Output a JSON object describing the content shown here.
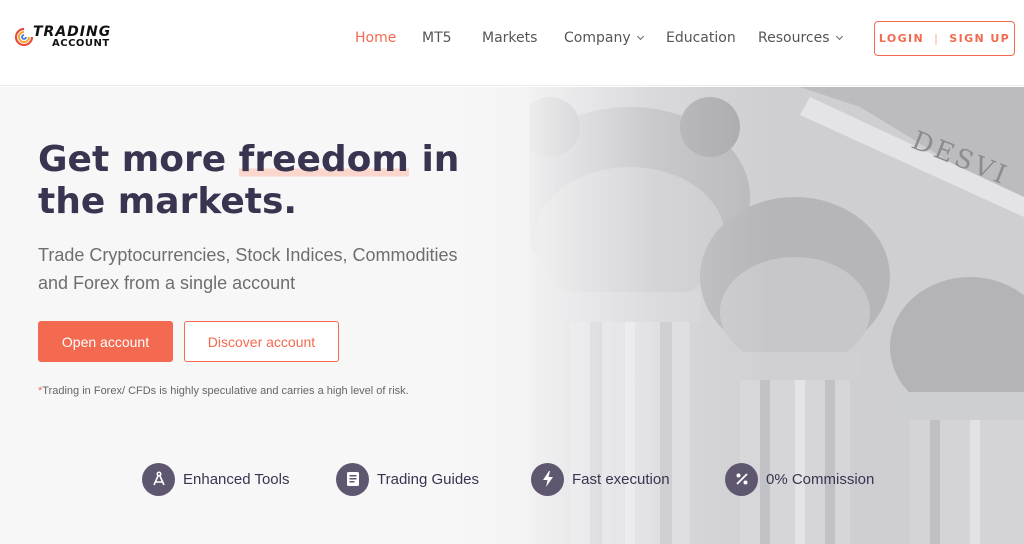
{
  "logo": {
    "line1": "TRADING",
    "line2": "ACCOUNT"
  },
  "nav": {
    "items": [
      {
        "label": "Home",
        "active": true
      },
      {
        "label": "MT5"
      },
      {
        "label": "Markets"
      },
      {
        "label": "Company",
        "dropdown": true
      },
      {
        "label": "Education"
      },
      {
        "label": "Resources",
        "dropdown": true
      }
    ],
    "login": "LOGIN",
    "separator": "|",
    "signup": "SIGN UP"
  },
  "hero": {
    "headline_pre": "Get more ",
    "headline_highlight": "freedom",
    "headline_post": " in the markets.",
    "subtitle": "Trade Cryptocurrencies, Stock Indices, Commodities and Forex from a single account",
    "primary_button": "Open account",
    "secondary_button": "Discover account",
    "risk_star": "*",
    "risk_text": "Trading in Forex/ CFDs is highly speculative and carries a high level of risk."
  },
  "features": [
    {
      "label": "Enhanced Tools",
      "icon": "compass-tools-icon"
    },
    {
      "label": "Trading Guides",
      "icon": "guide-book-icon"
    },
    {
      "label": "Fast execution",
      "icon": "lightning-icon"
    },
    {
      "label": "0% Commission",
      "icon": "percent-icon"
    }
  ],
  "colors": {
    "accent": "#f36a50",
    "heading": "#3a3451",
    "icon_bg": "#5f566f",
    "highlight": "#fbd6cd"
  }
}
